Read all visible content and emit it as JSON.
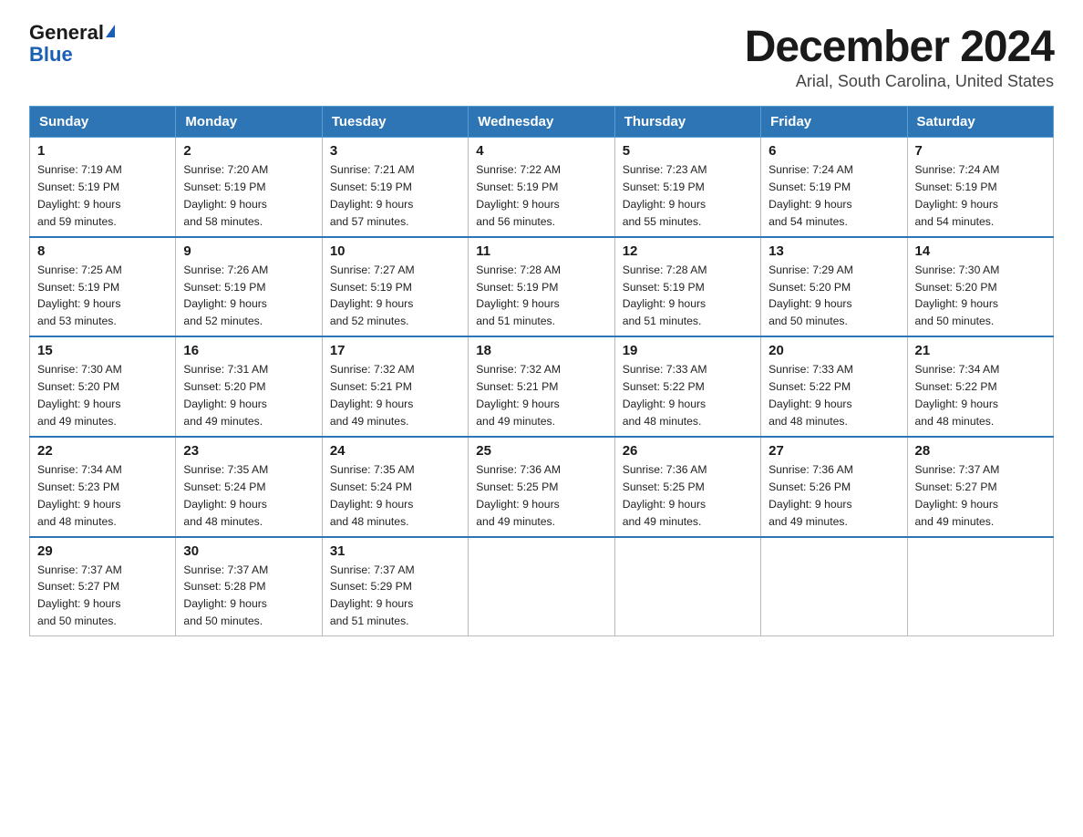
{
  "logo": {
    "general": "General",
    "blue": "Blue"
  },
  "title": "December 2024",
  "location": "Arial, South Carolina, United States",
  "days_of_week": [
    "Sunday",
    "Monday",
    "Tuesday",
    "Wednesday",
    "Thursday",
    "Friday",
    "Saturday"
  ],
  "weeks": [
    [
      {
        "day": "1",
        "sunrise": "7:19 AM",
        "sunset": "5:19 PM",
        "daylight": "9 hours and 59 minutes."
      },
      {
        "day": "2",
        "sunrise": "7:20 AM",
        "sunset": "5:19 PM",
        "daylight": "9 hours and 58 minutes."
      },
      {
        "day": "3",
        "sunrise": "7:21 AM",
        "sunset": "5:19 PM",
        "daylight": "9 hours and 57 minutes."
      },
      {
        "day": "4",
        "sunrise": "7:22 AM",
        "sunset": "5:19 PM",
        "daylight": "9 hours and 56 minutes."
      },
      {
        "day": "5",
        "sunrise": "7:23 AM",
        "sunset": "5:19 PM",
        "daylight": "9 hours and 55 minutes."
      },
      {
        "day": "6",
        "sunrise": "7:24 AM",
        "sunset": "5:19 PM",
        "daylight": "9 hours and 54 minutes."
      },
      {
        "day": "7",
        "sunrise": "7:24 AM",
        "sunset": "5:19 PM",
        "daylight": "9 hours and 54 minutes."
      }
    ],
    [
      {
        "day": "8",
        "sunrise": "7:25 AM",
        "sunset": "5:19 PM",
        "daylight": "9 hours and 53 minutes."
      },
      {
        "day": "9",
        "sunrise": "7:26 AM",
        "sunset": "5:19 PM",
        "daylight": "9 hours and 52 minutes."
      },
      {
        "day": "10",
        "sunrise": "7:27 AM",
        "sunset": "5:19 PM",
        "daylight": "9 hours and 52 minutes."
      },
      {
        "day": "11",
        "sunrise": "7:28 AM",
        "sunset": "5:19 PM",
        "daylight": "9 hours and 51 minutes."
      },
      {
        "day": "12",
        "sunrise": "7:28 AM",
        "sunset": "5:19 PM",
        "daylight": "9 hours and 51 minutes."
      },
      {
        "day": "13",
        "sunrise": "7:29 AM",
        "sunset": "5:20 PM",
        "daylight": "9 hours and 50 minutes."
      },
      {
        "day": "14",
        "sunrise": "7:30 AM",
        "sunset": "5:20 PM",
        "daylight": "9 hours and 50 minutes."
      }
    ],
    [
      {
        "day": "15",
        "sunrise": "7:30 AM",
        "sunset": "5:20 PM",
        "daylight": "9 hours and 49 minutes."
      },
      {
        "day": "16",
        "sunrise": "7:31 AM",
        "sunset": "5:20 PM",
        "daylight": "9 hours and 49 minutes."
      },
      {
        "day": "17",
        "sunrise": "7:32 AM",
        "sunset": "5:21 PM",
        "daylight": "9 hours and 49 minutes."
      },
      {
        "day": "18",
        "sunrise": "7:32 AM",
        "sunset": "5:21 PM",
        "daylight": "9 hours and 49 minutes."
      },
      {
        "day": "19",
        "sunrise": "7:33 AM",
        "sunset": "5:22 PM",
        "daylight": "9 hours and 48 minutes."
      },
      {
        "day": "20",
        "sunrise": "7:33 AM",
        "sunset": "5:22 PM",
        "daylight": "9 hours and 48 minutes."
      },
      {
        "day": "21",
        "sunrise": "7:34 AM",
        "sunset": "5:22 PM",
        "daylight": "9 hours and 48 minutes."
      }
    ],
    [
      {
        "day": "22",
        "sunrise": "7:34 AM",
        "sunset": "5:23 PM",
        "daylight": "9 hours and 48 minutes."
      },
      {
        "day": "23",
        "sunrise": "7:35 AM",
        "sunset": "5:24 PM",
        "daylight": "9 hours and 48 minutes."
      },
      {
        "day": "24",
        "sunrise": "7:35 AM",
        "sunset": "5:24 PM",
        "daylight": "9 hours and 48 minutes."
      },
      {
        "day": "25",
        "sunrise": "7:36 AM",
        "sunset": "5:25 PM",
        "daylight": "9 hours and 49 minutes."
      },
      {
        "day": "26",
        "sunrise": "7:36 AM",
        "sunset": "5:25 PM",
        "daylight": "9 hours and 49 minutes."
      },
      {
        "day": "27",
        "sunrise": "7:36 AM",
        "sunset": "5:26 PM",
        "daylight": "9 hours and 49 minutes."
      },
      {
        "day": "28",
        "sunrise": "7:37 AM",
        "sunset": "5:27 PM",
        "daylight": "9 hours and 49 minutes."
      }
    ],
    [
      {
        "day": "29",
        "sunrise": "7:37 AM",
        "sunset": "5:27 PM",
        "daylight": "9 hours and 50 minutes."
      },
      {
        "day": "30",
        "sunrise": "7:37 AM",
        "sunset": "5:28 PM",
        "daylight": "9 hours and 50 minutes."
      },
      {
        "day": "31",
        "sunrise": "7:37 AM",
        "sunset": "5:29 PM",
        "daylight": "9 hours and 51 minutes."
      },
      null,
      null,
      null,
      null
    ]
  ],
  "labels": {
    "sunrise": "Sunrise:",
    "sunset": "Sunset:",
    "daylight": "Daylight:"
  },
  "colors": {
    "header_bg": "#2e75b6",
    "accent": "#1a5fb4"
  }
}
